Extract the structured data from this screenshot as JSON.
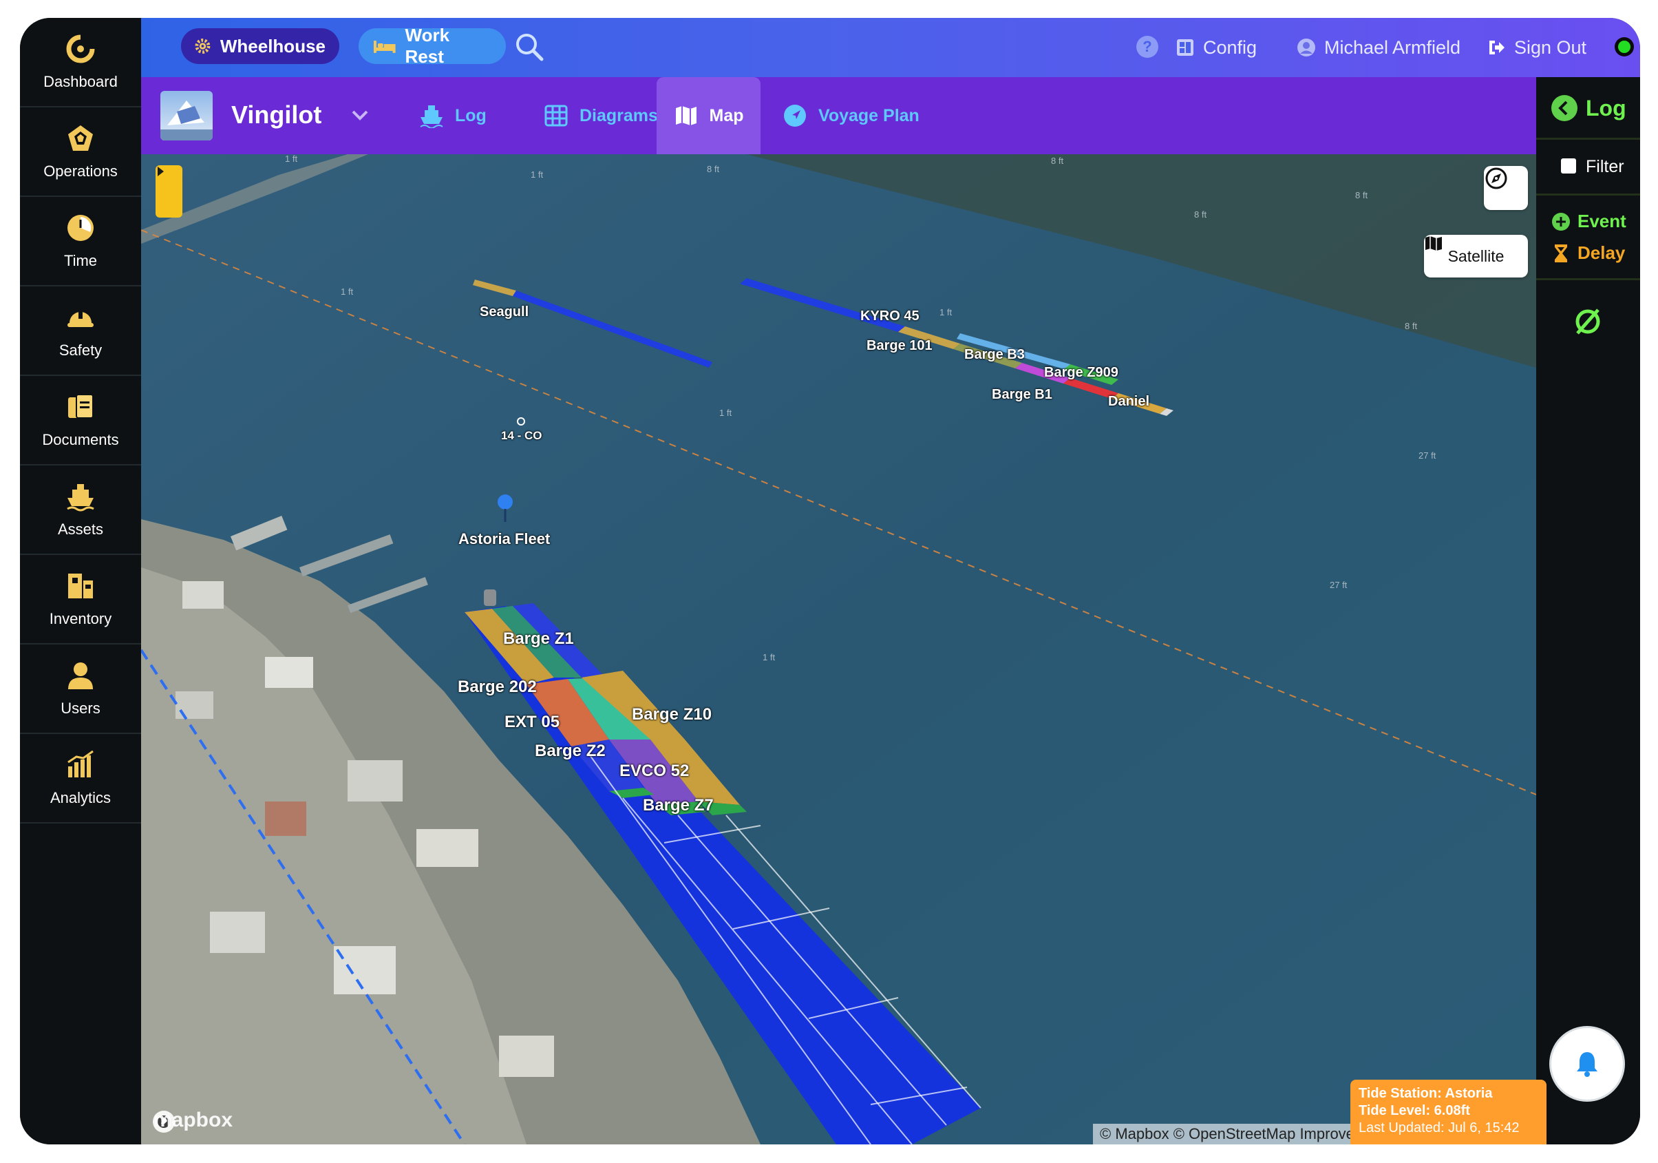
{
  "sidebar": {
    "items": [
      {
        "label": "Dashboard",
        "icon": "dashboard-icon"
      },
      {
        "label": "Operations",
        "icon": "operations-icon"
      },
      {
        "label": "Time",
        "icon": "clock-icon"
      },
      {
        "label": "Safety",
        "icon": "hardhat-icon"
      },
      {
        "label": "Documents",
        "icon": "documents-icon"
      },
      {
        "label": "Assets",
        "icon": "ship-icon"
      },
      {
        "label": "Inventory",
        "icon": "inventory-icon"
      },
      {
        "label": "Users",
        "icon": "user-icon"
      },
      {
        "label": "Analytics",
        "icon": "analytics-icon"
      }
    ]
  },
  "topbar": {
    "wheelhouse_label": "Wheelhouse",
    "workrest_label": "Work Rest",
    "help_label": "?",
    "config_label": "Config",
    "user_name": "Michael Armfield",
    "signout_label": "Sign Out",
    "status_color": "#22dd22"
  },
  "vessel": {
    "name": "Vingilot",
    "tabs": [
      {
        "label": "Log",
        "active": false
      },
      {
        "label": "Diagrams",
        "active": false
      },
      {
        "label": "Map",
        "active": true
      },
      {
        "label": "Voyage Plan",
        "active": false
      }
    ]
  },
  "right_panel": {
    "log_label": "Log",
    "filter_label": "Filter",
    "event_label": "Event",
    "delay_label": "Delay"
  },
  "map": {
    "satellite_label": "Satellite",
    "logo_text": "mapbox",
    "attribution": "© Mapbox © OpenStreetMap  Improve this map © Maxar",
    "tide": {
      "station": "Tide Station: Astoria",
      "level": "Tide Level: 6.08ft",
      "updated": "Last Updated: Jul 6, 15:42"
    },
    "labels": [
      "Seagull",
      "KYRO 45",
      "Barge 101",
      "Barge B3",
      "Barge Z909",
      "Barge B1",
      "Daniel",
      "14 - CO",
      "Astoria Fleet",
      "Barge Z1",
      "Barge 202",
      "Barge Z10",
      "EXT 05",
      "Barge Z2",
      "EVCO 52",
      "Barge Z7"
    ],
    "depths": [
      "1 ft",
      "1 ft",
      "8 ft",
      "8 ft",
      "8 ft",
      "8 ft",
      "1 ft",
      "1 ft",
      "1 ft",
      "8 ft",
      "27 ft",
      "27 ft",
      "1 ft"
    ]
  }
}
